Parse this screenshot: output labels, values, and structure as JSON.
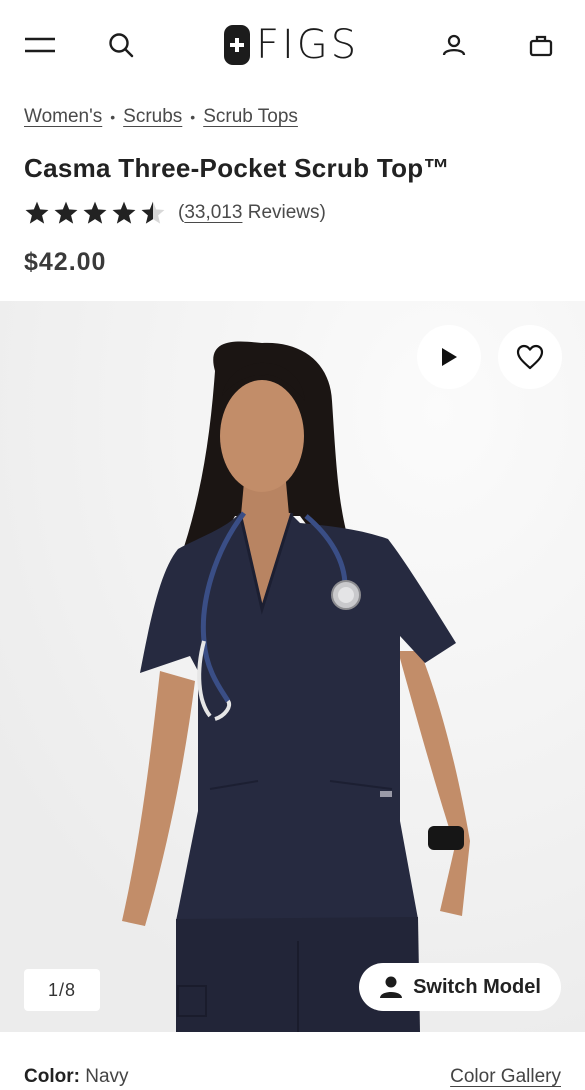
{
  "header": {
    "brand": "FIGS",
    "icons": [
      "menu-icon",
      "search-icon",
      "account-icon",
      "bag-icon"
    ]
  },
  "breadcrumb": [
    "Women's",
    "Scrubs",
    "Scrub Tops"
  ],
  "product": {
    "title": "Casma Three-Pocket Scrub Top™",
    "rating": 4.5,
    "review_count": "33,013",
    "review_open": "(",
    "review_suffix": " Reviews)",
    "price": "$42.00"
  },
  "gallery": {
    "counter": "1/8",
    "switch_model_label": "Switch Model",
    "icons": [
      "play-icon",
      "heart-icon",
      "person-icon"
    ]
  },
  "color": {
    "label": "Color:",
    "value": "Navy",
    "gallery_link": "Color Gallery"
  },
  "colors": {
    "text": "#1f1f1f",
    "navy": "#262a40",
    "gallery_bg": "#f2f2f2"
  }
}
